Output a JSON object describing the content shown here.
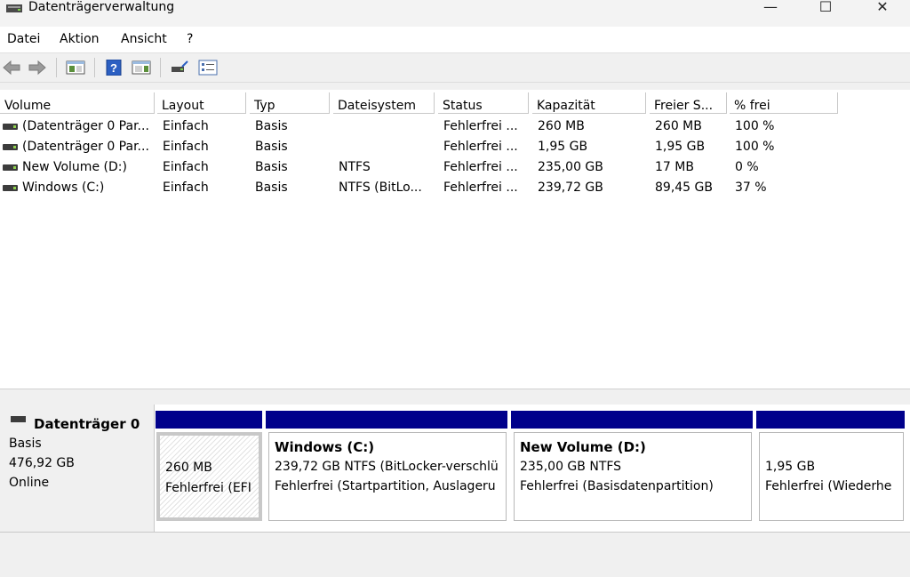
{
  "window": {
    "title": "Datenträgerverwaltung",
    "minimize_glyph": "—",
    "maximize_glyph": "☐",
    "close_glyph": "✕"
  },
  "menu": [
    "Datei",
    "Aktion",
    "Ansicht",
    "?"
  ],
  "toolbar": {
    "icons": [
      "back-arrow-icon",
      "forward-arrow-icon",
      "console-tree-icon",
      "help-icon",
      "properties-pane-icon",
      "connect-icon",
      "checklist-icon"
    ]
  },
  "volume_list": {
    "columns": [
      "Volume",
      "Layout",
      "Typ",
      "Dateisystem",
      "Status",
      "Kapazität",
      "Freier S...",
      "% frei"
    ],
    "rows": [
      [
        "(Datenträger 0 Par...",
        "Einfach",
        "Basis",
        "",
        "Fehlerfrei ...",
        "260 MB",
        "260 MB",
        "100 %"
      ],
      [
        "(Datenträger 0 Par...",
        "Einfach",
        "Basis",
        "",
        "Fehlerfrei ...",
        "1,95 GB",
        "1,95 GB",
        "100 %"
      ],
      [
        "New Volume (D:)",
        "Einfach",
        "Basis",
        "NTFS",
        "Fehlerfrei ...",
        "235,00 GB",
        "17 MB",
        "0 %"
      ],
      [
        "Windows (C:)",
        "Einfach",
        "Basis",
        "NTFS (BitLo...",
        "Fehlerfrei ...",
        "239,72 GB",
        "89,45 GB",
        "37 %"
      ]
    ]
  },
  "disk": {
    "name": "Datenträger 0",
    "type": "Basis",
    "size": "476,92 GB",
    "state": "Online",
    "partitions": [
      {
        "title": "",
        "line1": "260 MB",
        "line2": "Fehlerfrei (EFI"
      },
      {
        "title": "Windows  (C:)",
        "line1": "239,72 GB NTFS (BitLocker-verschlü",
        "line2": "Fehlerfrei (Startpartition, Auslageru"
      },
      {
        "title": "New Volume  (D:)",
        "line1": "235,00 GB NTFS",
        "line2": "Fehlerfrei (Basisdatenpartition)"
      },
      {
        "title": "",
        "line1": "1,95 GB",
        "line2": "Fehlerfrei (Wiederhe"
      }
    ]
  },
  "colors": {
    "partition_bar": "#00008b",
    "window_bg": "#f0f0f0"
  }
}
